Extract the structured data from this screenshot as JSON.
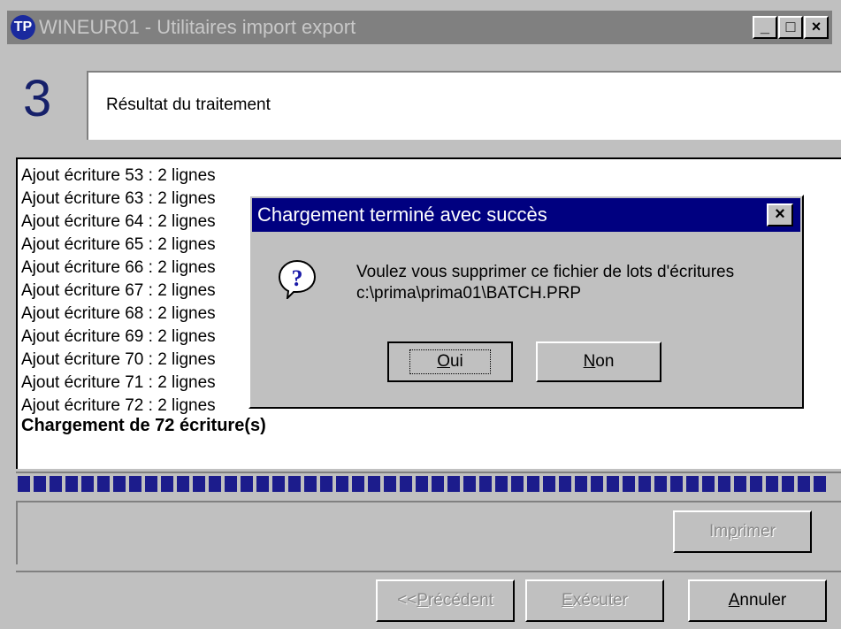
{
  "window": {
    "title": "WINEUR01 - Utilitaires import export",
    "minimize": "_",
    "maximize": "□",
    "close": "×"
  },
  "step": {
    "number": "3",
    "label": "Résultat du traitement"
  },
  "log": {
    "lines": [
      "Ajout écriture 53 : 2 lignes",
      "Ajout écriture 63 : 2 lignes",
      "Ajout écriture 64 : 2 lignes",
      "Ajout écriture 65 : 2 lignes",
      "Ajout écriture 66 : 2 lignes",
      "Ajout écriture 67 : 2 lignes",
      "Ajout écriture 68 : 2 lignes",
      "Ajout écriture 69 : 2 lignes",
      "Ajout écriture 70 : 2 lignes",
      "Ajout écriture 71 : 2 lignes",
      "Ajout écriture 72 : 2 lignes"
    ],
    "summary": "Chargement de 72 écriture(s)"
  },
  "progress": {
    "value": 1.0
  },
  "buttons": {
    "print": {
      "prefix": "Im",
      "key": "p",
      "suffix": "rimer",
      "enabled": false
    },
    "previous": {
      "prefix": "<< ",
      "key": "P",
      "suffix": "récédent",
      "enabled": false
    },
    "execute": {
      "prefix": "",
      "key": "E",
      "suffix": "xécuter",
      "enabled": false
    },
    "cancel": {
      "prefix": "",
      "key": "A",
      "suffix": "nnuler",
      "enabled": true
    }
  },
  "dialog": {
    "title": "Chargement terminé avec succès",
    "close": "×",
    "icon": "question-icon",
    "message_line1": "Voulez vous supprimer ce fichier de lots d'écritures",
    "message_line2": "c:\\prima\\prima01\\BATCH.PRP",
    "yes": {
      "key": "O",
      "suffix": "ui"
    },
    "no": {
      "key": "N",
      "suffix": "on"
    }
  },
  "colors": {
    "titlebar_inactive": "#808080",
    "dialog_titlebar": "#000080",
    "progress": "#1c1c8c",
    "face": "#c0c0c0"
  }
}
